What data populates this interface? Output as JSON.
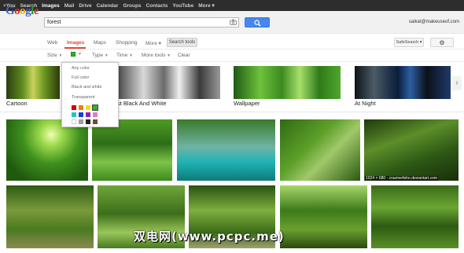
{
  "topbar": {
    "items": [
      {
        "label": "+You",
        "active": false
      },
      {
        "label": "Search",
        "active": false
      },
      {
        "label": "Images",
        "active": true
      },
      {
        "label": "Mail",
        "active": false
      },
      {
        "label": "Drive",
        "active": false
      },
      {
        "label": "Calendar",
        "active": false
      },
      {
        "label": "Groups",
        "active": false
      },
      {
        "label": "Contacts",
        "active": false
      },
      {
        "label": "YouTube",
        "active": false
      },
      {
        "label": "More ▾",
        "active": false
      }
    ]
  },
  "logo": {
    "letters": [
      "G",
      "o",
      "o",
      "g",
      "l",
      "e"
    ]
  },
  "search": {
    "value": "forest",
    "user": "saikat@makeuseof.com"
  },
  "tabs": {
    "web": "Web",
    "images": "Images",
    "maps": "Maps",
    "shopping": "Shopping",
    "more": "More ▾",
    "search_tools": "Search tools",
    "safesearch": "SafeSearch ▾",
    "gear": "⚙"
  },
  "tools": {
    "size": "Size",
    "type": "Type",
    "time": "Time",
    "more_tools": "More tools",
    "clear": "Clear",
    "selected_color": "#2db51e"
  },
  "color_menu": {
    "options": [
      "Any color",
      "Full color",
      "Black and white",
      "Transparent"
    ],
    "swatches": [
      "#cc0000",
      "#f57c00",
      "#f9e000",
      "#2db51e",
      "#26c6c6",
      "#1a3fd6",
      "#8e24aa",
      "#e57ac4",
      "#ffffff",
      "#9e9e9e",
      "#212121",
      "#6d4c2e"
    ],
    "selected_swatch": 3
  },
  "related": {
    "labels": [
      "Cartoon",
      "st Black And White",
      "Wallpaper",
      "At Night"
    ]
  },
  "image_caption": "1024 × 680 - crazme4sho.deviantart.com",
  "watermark": "双电网(www.pcpc.me)"
}
